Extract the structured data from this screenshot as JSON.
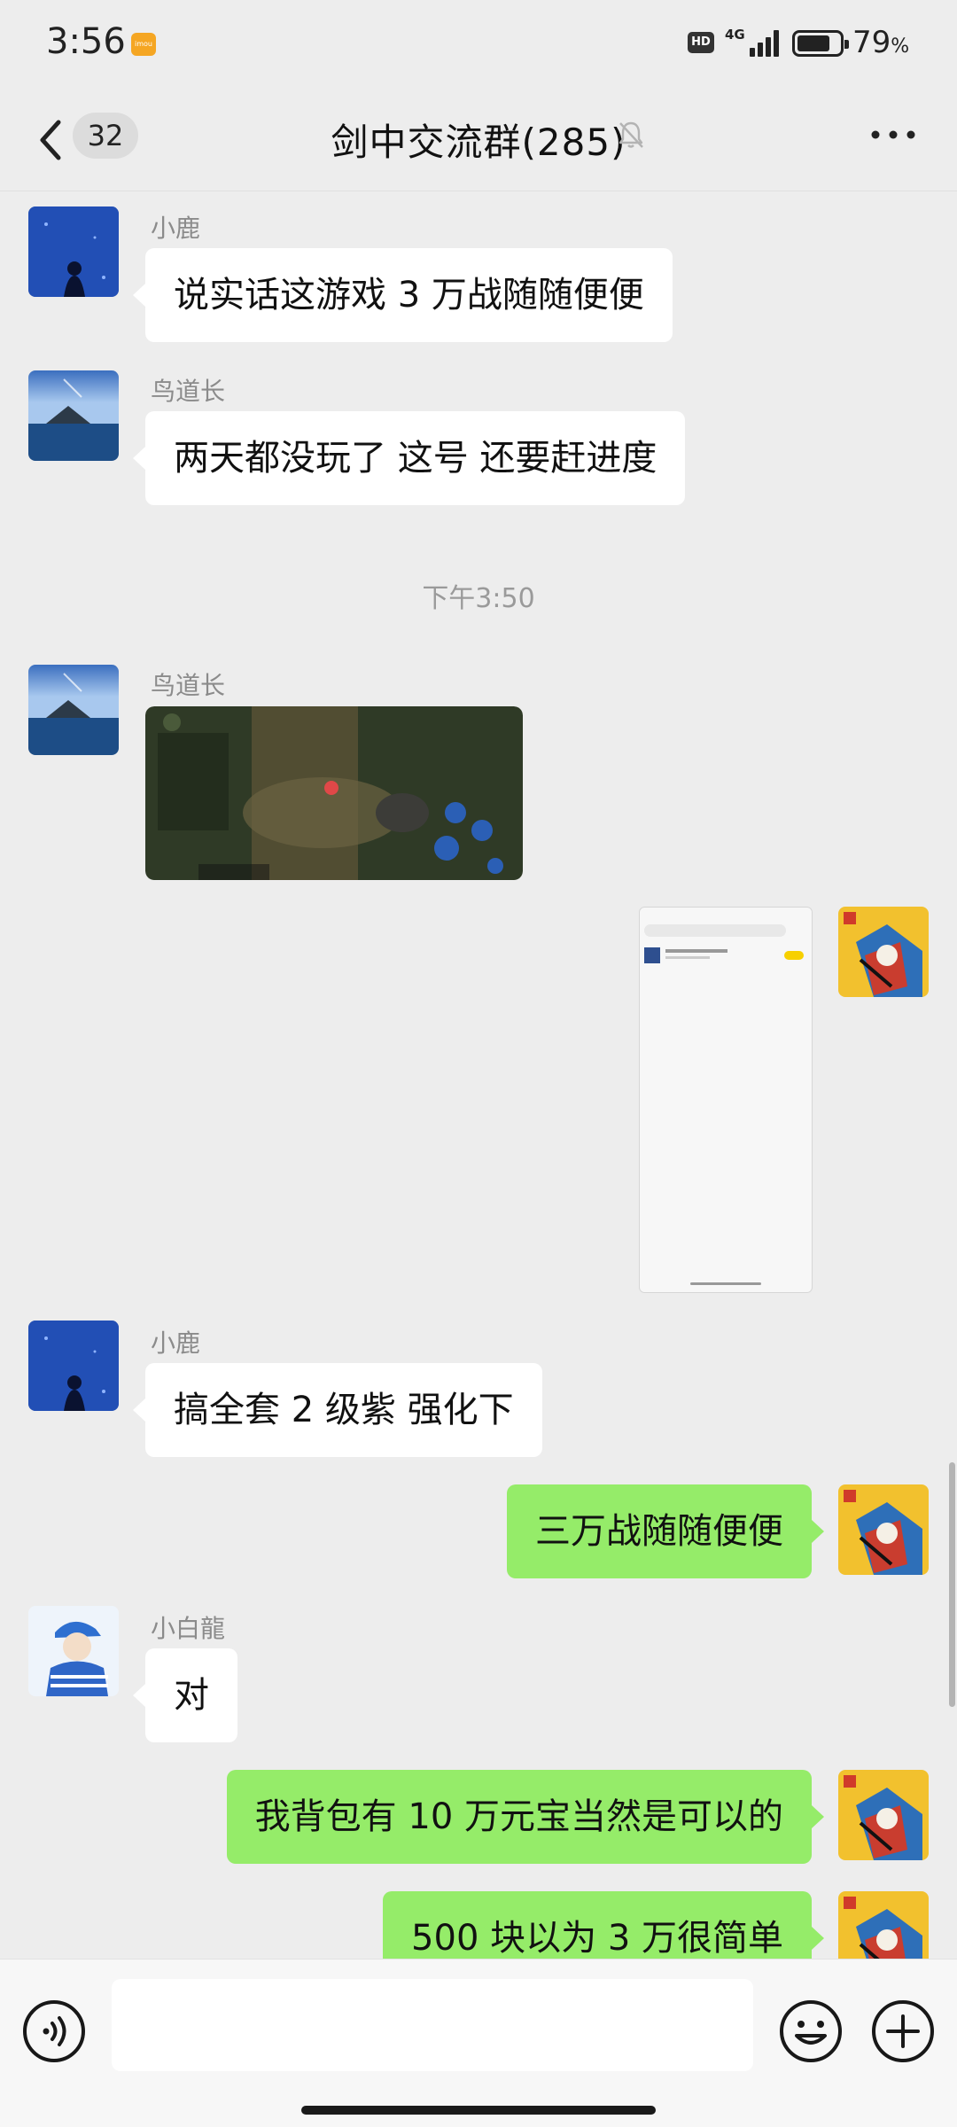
{
  "status_bar": {
    "time": "3:56",
    "app_badge": "imou",
    "hd": "HD",
    "network": "4G",
    "battery_percent": "79",
    "battery_unit": "%",
    "battery_level": 0.79
  },
  "header": {
    "unread_count": "32",
    "title": "剑中交流群(285)",
    "muted": true
  },
  "messages": {
    "m1": {
      "sender": "小鹿",
      "text": "说实话这游戏 3 万战随随便便"
    },
    "m2": {
      "sender": "鸟道长",
      "text": "两天都没玩了 这号 还要赶进度"
    },
    "timestamp": "下午3:50",
    "m3": {
      "sender": "鸟道长",
      "type": "image",
      "image_desc": "game-screenshot"
    },
    "m4": {
      "type": "image",
      "image_desc": "phone-screenshot"
    },
    "m5": {
      "sender": "小鹿",
      "text": "搞全套 2 级紫 强化下"
    },
    "m6": {
      "text": "三万战随随便便"
    },
    "m7": {
      "sender": "小白龍",
      "text": "对"
    },
    "m8": {
      "text": "我背包有 10 万元宝当然是可以的"
    },
    "m9": {
      "text": "500 块以为 3 万很简单"
    }
  },
  "colors": {
    "background": "#ededed",
    "incoming_bubble": "#ffffff",
    "outgoing_bubble": "#95ec69",
    "sender_name": "#8b8b8b"
  },
  "input_bar": {
    "voice_icon": "voice-icon",
    "emoji_icon": "emoji-icon",
    "plus_icon": "plus-icon"
  }
}
